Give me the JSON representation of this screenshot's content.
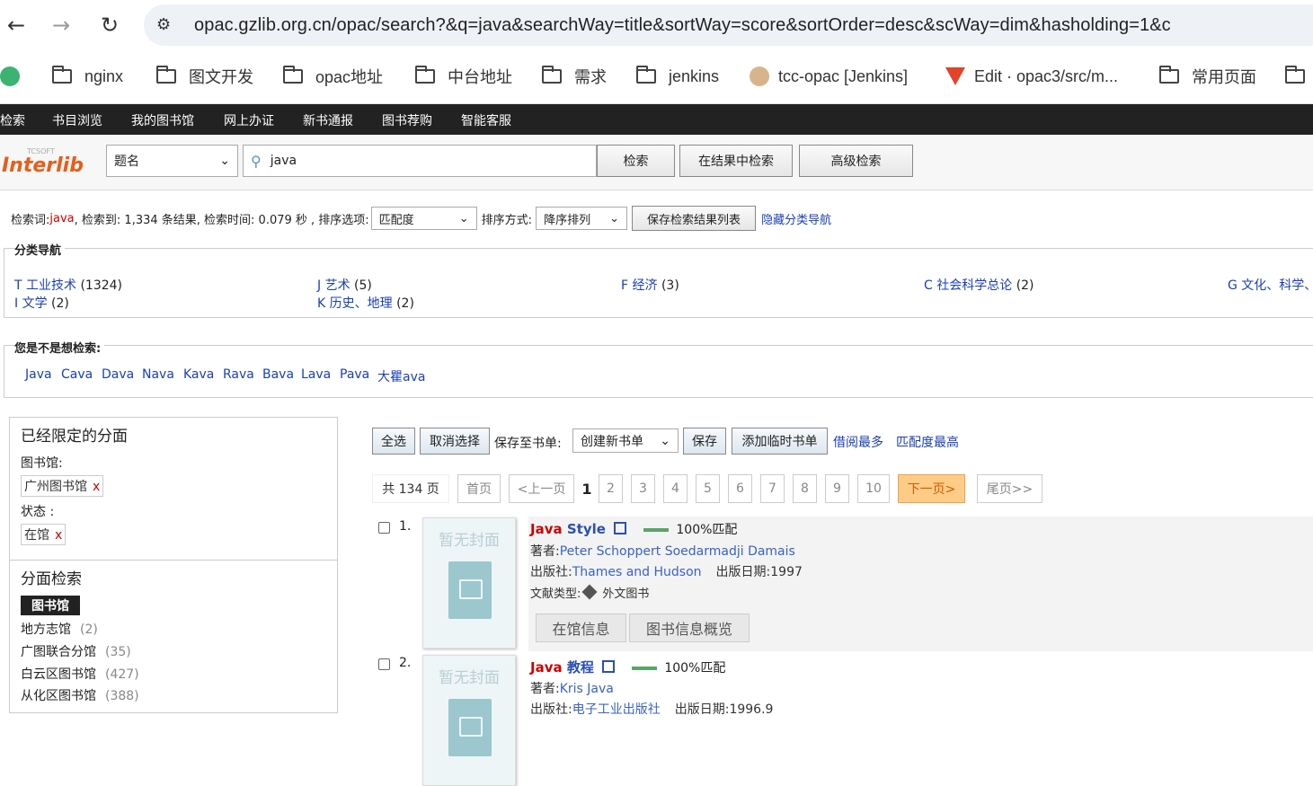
{
  "browser": {
    "back": "←",
    "forward": "→",
    "reload": "↻",
    "url": "opac.gzlib.org.cn/opac/search?&q=java&searchWay=title&sortWay=score&sortOrder=desc&scWay=dim&hasholding=1&c",
    "bookmarks": [
      "nginx",
      "图文开发",
      "opac地址",
      "中台地址",
      "需求",
      "jenkins",
      "tcc-opac [Jenkins]",
      "Edit · opac3/src/m...",
      "常用页面"
    ]
  },
  "topnav": [
    "检索",
    "书目浏览",
    "我的图书馆",
    "网上办证",
    "新书通报",
    "图书荐购",
    "智能客服"
  ],
  "search": {
    "logo_small": "TCSOFT",
    "logo": "Interlib",
    "field": "题名",
    "query": "java",
    "btn_search": "检索",
    "btn_in_results": "在结果中检索",
    "btn_advanced": "高级检索"
  },
  "info": {
    "label_term": "检索词: ",
    "term": "java",
    "mid": " , 检索到: 1,334 条结果, 检索时间: 0.079 秒 , 排序选项:",
    "sort_option": "匹配度",
    "sort_label": "排序方式:",
    "sort_order": "降序排列",
    "save_btn": "保存检索结果列表",
    "hide_nav": "隐藏分类导航"
  },
  "category_nav": {
    "title": "分类导航",
    "items": [
      {
        "name": "T 工业技术",
        "count": "(1324)"
      },
      {
        "name": "J 艺术",
        "count": "(5)"
      },
      {
        "name": "F 经济",
        "count": "(3)"
      },
      {
        "name": "C 社会科学总论",
        "count": "(2)"
      },
      {
        "name": "G 文化、科学、",
        "count": ""
      },
      {
        "name": "I 文学",
        "count": "(2)"
      },
      {
        "name": "K 历史、地理",
        "count": "(2)"
      }
    ]
  },
  "suggest": {
    "title": "您是不是想检索:",
    "words": [
      "Java",
      "Cava",
      "Dava",
      "Nava",
      "Kava",
      "Rava",
      "Bava",
      "Lava",
      "Pava",
      "大瞿ava"
    ]
  },
  "sidebar": {
    "limited_title": "已经限定的分面",
    "lib_label": "图书馆:",
    "lib_tag": "广州图书馆",
    "status_label": "状态 :",
    "status_tag": "在馆",
    "remove": "x",
    "facet_title": "分面检索",
    "facet_head": "图书馆",
    "facets": [
      {
        "name": "地方志馆",
        "count": "(2)"
      },
      {
        "name": "广图联合分馆",
        "count": "(35)"
      },
      {
        "name": "白云区图书馆",
        "count": "(427)"
      },
      {
        "name": "从化区图书馆",
        "count": "(388)"
      }
    ]
  },
  "toolbar": {
    "select_all": "全选",
    "deselect": "取消选择",
    "save_to": "保存至书单:",
    "new_list": "创建新书单",
    "save": "保存",
    "add_temp": "添加临时书单",
    "most_borrowed": "借阅最多",
    "best_match": "匹配度最高"
  },
  "pager": {
    "total": "共 134 页",
    "first": "首页",
    "prev": "<上一页",
    "pages": [
      "1",
      "2",
      "3",
      "4",
      "5",
      "6",
      "7",
      "8",
      "9",
      "10"
    ],
    "next": "下一页>",
    "last": "尾页>>"
  },
  "results": [
    {
      "num": "1.",
      "cover_text": "暂无封面",
      "title_red": "Java",
      "title_blue": "Style",
      "match": "100%匹配",
      "author_label": "著者:",
      "author": "Peter Schoppert Soedarmadji Damais",
      "publisher_label": "出版社:",
      "publisher": "Thames and Hudson",
      "date_label": "出版日期:",
      "date": "1997",
      "type_label": "文献类型:",
      "type": "外文图书",
      "tab1": "在馆信息",
      "tab2": "图书信息概览"
    },
    {
      "num": "2.",
      "cover_text": "暂无封面",
      "title_red": "Java",
      "title_blue": "教程",
      "match": "100%匹配",
      "author_label": "著者:",
      "author": "Kris Java",
      "publisher_label": "出版社:",
      "publisher": "电子工业出版社",
      "date_label": "出版日期:",
      "date": "1996.9"
    }
  ],
  "colors": {
    "topnav": "#222222",
    "link": "#1a3fb8",
    "highlight": "#cc0000",
    "next_page": "#ffcc88"
  }
}
